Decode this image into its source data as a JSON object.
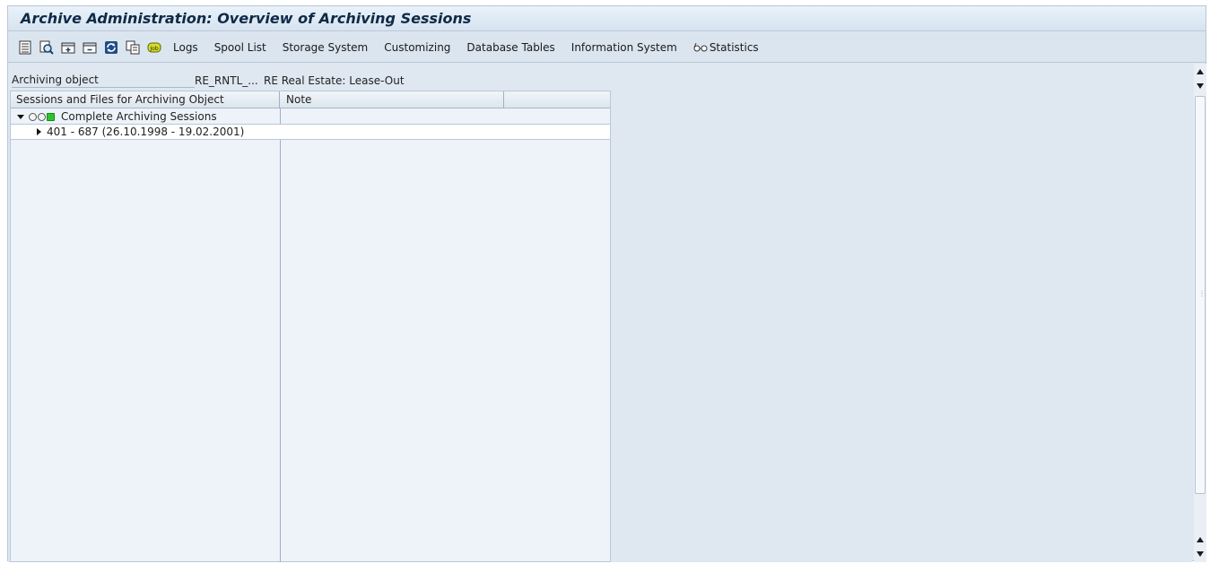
{
  "window": {
    "title": "Archive Administration: Overview of Archiving Sessions"
  },
  "toolbar": {
    "icons": [
      "detail-list-icon",
      "find-icon",
      "expand-icon",
      "collapse-icon",
      "refresh-icon",
      "copy-icon",
      "job-icon"
    ],
    "buttons": [
      {
        "label": "Logs"
      },
      {
        "label": "Spool List"
      },
      {
        "label": "Storage System"
      },
      {
        "label": "Customizing"
      },
      {
        "label": "Database Tables"
      },
      {
        "label": "Information System"
      },
      {
        "label": "Statistics",
        "icon": "glasses-icon"
      }
    ]
  },
  "header": {
    "archiving_object_label": "Archiving object",
    "archiving_object_value": "RE_RNTL_...",
    "archiving_object_desc": "RE Real Estate: Lease-Out"
  },
  "tree": {
    "columns": [
      "Sessions and Files for Archiving Object",
      "Note"
    ],
    "rows": [
      {
        "label": "Complete Archiving Sessions",
        "expanded": true,
        "status_lights": [
          "off",
          "off",
          "green"
        ],
        "note": ""
      },
      {
        "label": "401 - 687 (26.10.1998 - 19.02.2001)",
        "expanded": false,
        "note": ""
      }
    ]
  },
  "colors": {
    "title_text": "#0f2a47",
    "background": "#dfe8f1",
    "tree_background": "#edf3f9",
    "status_green": "#2ec32e"
  }
}
